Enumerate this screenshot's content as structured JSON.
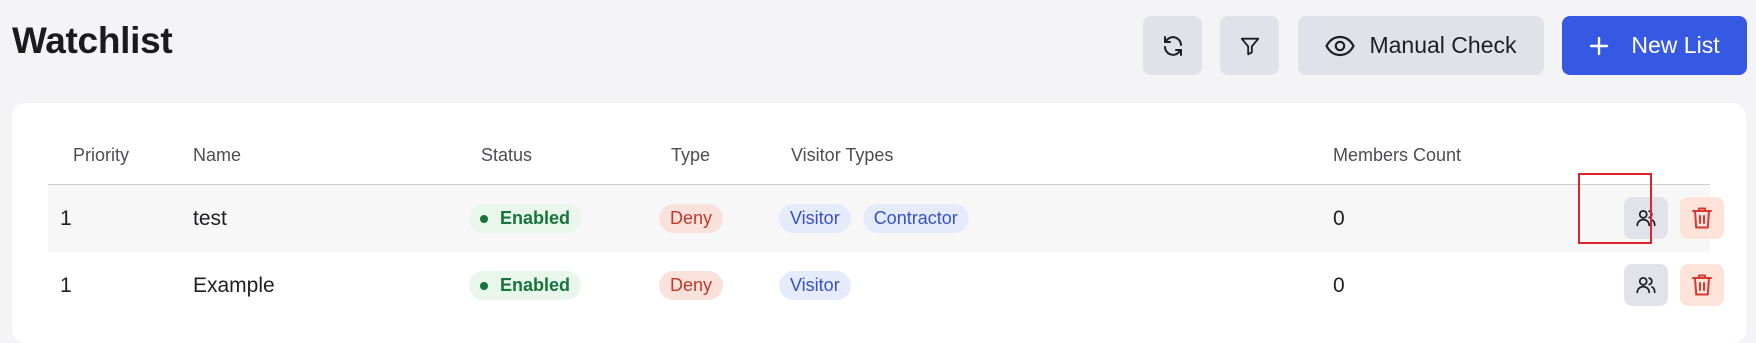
{
  "header": {
    "title": "Watchlist",
    "refresh_icon": "refresh-icon",
    "filter_icon": "filter-icon",
    "manual_check_label": "Manual Check",
    "manual_check_icon": "eye-icon",
    "new_list_label": "New List",
    "new_list_icon": "plus-icon"
  },
  "table": {
    "columns": [
      "Priority",
      "Name",
      "Status",
      "Type",
      "Visitor Types",
      "Members Count"
    ],
    "rows": [
      {
        "priority": "1",
        "name": "test",
        "status": "Enabled",
        "type": "Deny",
        "visitor_types": [
          "Visitor",
          "Contractor"
        ],
        "members_count": "0"
      },
      {
        "priority": "1",
        "name": "Example",
        "status": "Enabled",
        "type": "Deny",
        "visitor_types": [
          "Visitor"
        ],
        "members_count": "0"
      }
    ]
  },
  "colors": {
    "accent": "#3559e3",
    "enabled": "#17743a",
    "deny": "#c0392b",
    "visitor_type": "#3651c7",
    "selection_highlight": "#e0242a"
  }
}
